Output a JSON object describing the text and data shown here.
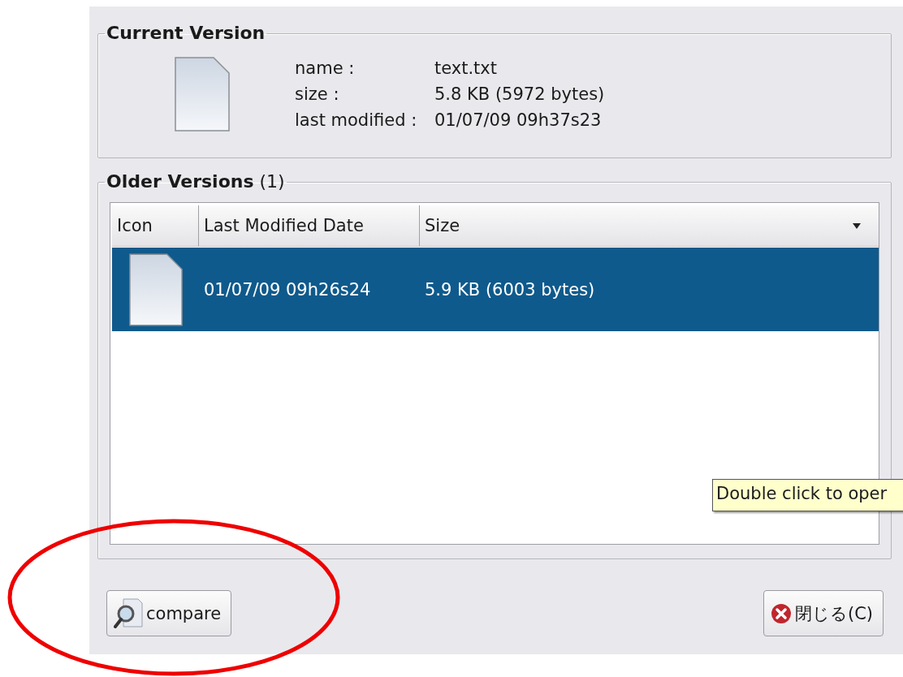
{
  "current_version": {
    "title": "Current Version",
    "fields": [
      {
        "label": "name :",
        "value": "text.txt"
      },
      {
        "label": "size :",
        "value": "5.8 KB (5972 bytes)"
      },
      {
        "label": "last modified :",
        "value": "01/07/09 09h37s23"
      }
    ]
  },
  "older_versions": {
    "title": "**Older Versions** (1)",
    "columns": [
      {
        "label": "Icon",
        "sorted": false
      },
      {
        "label": "Last Modified Date",
        "sorted": false
      },
      {
        "label": "Size",
        "sorted": true
      }
    ],
    "rows": [
      {
        "date": "01/07/09 09h26s24",
        "size": "5.9 KB (6003 bytes)",
        "selected": true
      }
    ]
  },
  "tooltip": "Double click to oper",
  "buttons": [
    {
      "kind": "compare",
      "label": "compare"
    },
    {
      "kind": "close",
      "label": "閉じる(C)"
    }
  ]
}
